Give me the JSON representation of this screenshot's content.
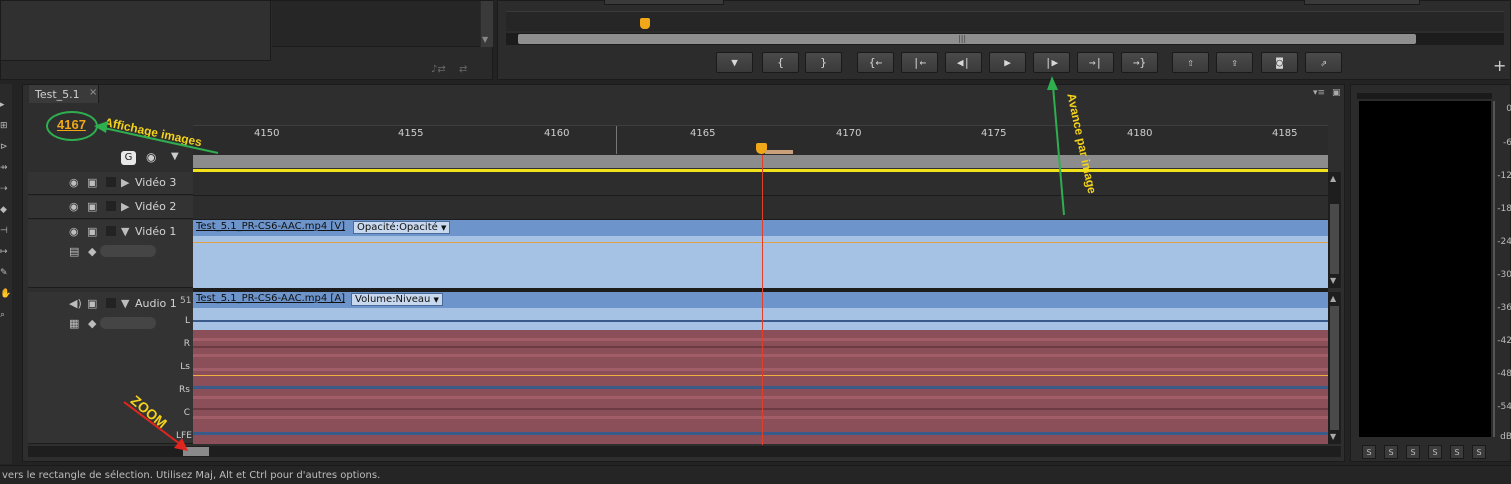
{
  "source_monitor": {
    "name": "source-monitor-panel"
  },
  "program_monitor": {
    "buttons": [
      {
        "name": "add-marker-button",
        "label": "▼",
        "icon": "marker-icon"
      },
      {
        "name": "mark-in-button",
        "label": "{",
        "icon": "mark-in-icon"
      },
      {
        "name": "mark-out-button",
        "label": "}",
        "icon": "mark-out-icon"
      },
      {
        "name": "go-to-in-button",
        "label": "{←",
        "icon": "go-to-in-icon"
      },
      {
        "name": "step-back-edit-button",
        "label": "|←",
        "icon": "previous-edit-icon"
      },
      {
        "name": "step-back-button",
        "label": "◀|",
        "icon": "step-back-icon"
      },
      {
        "name": "play-button",
        "label": "▶",
        "icon": "play-icon"
      },
      {
        "name": "step-forward-button",
        "label": "|▶",
        "icon": "step-forward-icon"
      },
      {
        "name": "next-edit-button",
        "label": "→|",
        "icon": "next-edit-icon"
      },
      {
        "name": "go-to-out-button",
        "label": "→}",
        "icon": "go-to-out-icon"
      },
      {
        "name": "lift-button",
        "label": "⇧",
        "icon": "lift-icon"
      },
      {
        "name": "extract-button",
        "label": "⇪",
        "icon": "extract-icon"
      },
      {
        "name": "export-frame-button",
        "label": "◙",
        "icon": "camera-icon"
      },
      {
        "name": "button-editor-button",
        "label": "⇗",
        "icon": "export-icon"
      }
    ],
    "add_button": "+"
  },
  "timeline": {
    "tab_label": "Test_5.1",
    "tab_close": "×",
    "timecode": "4167",
    "ruler": [
      "4150",
      "4155",
      "4160",
      "4165",
      "4170",
      "4175",
      "4180",
      "4185"
    ],
    "tracks": {
      "v3": "Vidéo 3",
      "v2": "Vidéo 2",
      "v1": "Vidéo 1",
      "a1": "Audio 1",
      "a1_mode": "51"
    },
    "video_clip": {
      "name": "Test_5.1_PR-CS6-AAC.mp4 [V]",
      "effect": "Opacité:Opacité"
    },
    "audio_clip": {
      "name": "Test_5.1_PR-CS6-AAC.mp4 [A]",
      "effect": "Volume:Niveau"
    },
    "channels": [
      "L",
      "R",
      "Ls",
      "Rs",
      "C",
      "LFE"
    ]
  },
  "annotations": {
    "affichage": "Affichage images",
    "avance": "Avance par image",
    "zoom": "ZOOM"
  },
  "meter": {
    "labels": [
      "0",
      "-6",
      "-12",
      "-18",
      "-24",
      "-30",
      "-36",
      "-42",
      "-48",
      "-54",
      "dB"
    ],
    "solo_buttons": [
      "S",
      "S",
      "S",
      "S",
      "S",
      "S"
    ]
  },
  "status_bar": {
    "text": "vers le rectangle de sélection. Utilisez Maj, Alt et Ctrl pour d'autres options."
  },
  "colors": {
    "accent": "#f0a818",
    "annotation_green": "#2fae4f",
    "annotation_yellow": "#f2d21b",
    "video_clip": "#a5c1e3",
    "audio_clip": "#8a4f58",
    "playhead": "#e0402a"
  }
}
